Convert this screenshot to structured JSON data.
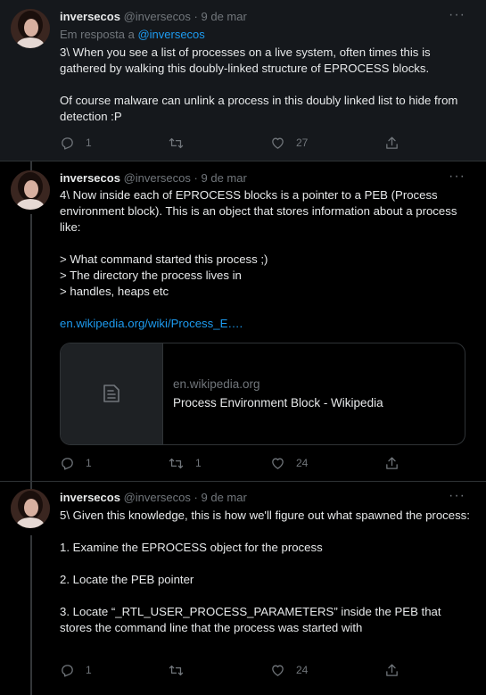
{
  "tweets": [
    {
      "name": "inversecos",
      "handle": "@inversecos",
      "separator": "·",
      "date": "9 de mar",
      "reply_prefix": "Em resposta a",
      "reply_handle": "@inversecos",
      "paragraphs": [
        "3\\ When you see a list of processes on a live system, often times this is gathered by walking this doubly-linked structure of EPROCESS blocks.",
        "Of course malware can unlink a process in this doubly linked list to hide from detection :P"
      ],
      "replies": "1",
      "retweets": "",
      "likes": "27"
    },
    {
      "name": "inversecos",
      "handle": "@inversecos",
      "separator": "·",
      "date": "9 de mar",
      "paragraphs": [
        "4\\ Now inside each of EPROCESS blocks is a pointer to a PEB (Process environment block). This is an object that stores information about a process like:",
        "> What command started this process ;)\n> The directory the process lives in\n> handles, heaps etc"
      ],
      "link_text": "en.wikipedia.org/wiki/Process_E….",
      "card": {
        "domain": "en.wikipedia.org",
        "title": "Process Environment Block - Wikipedia"
      },
      "replies": "1",
      "retweets": "1",
      "likes": "24"
    },
    {
      "name": "inversecos",
      "handle": "@inversecos",
      "separator": "·",
      "date": "9 de mar",
      "paragraphs": [
        "5\\ Given this knowledge, this is how we'll figure out what spawned the process:",
        "1. Examine the EPROCESS object for the process",
        "2. Locate the PEB pointer",
        "3.  Locate “_RTL_USER_PROCESS_PARAMETERS”  inside the PEB that stores the command line that the process was started with"
      ],
      "replies": "1",
      "retweets": "",
      "likes": "24"
    }
  ],
  "icons": {
    "more": "more-horizontal-icon",
    "reply": "reply-icon",
    "retweet": "retweet-icon",
    "like": "heart-icon",
    "share": "share-icon",
    "card_placeholder": "document-icon"
  },
  "colors": {
    "background": "#000000",
    "highlighted_background": "#15181c",
    "text": "#e7e9ea",
    "muted": "#71767b",
    "link": "#1d9bf0",
    "border": "#2f3336"
  }
}
